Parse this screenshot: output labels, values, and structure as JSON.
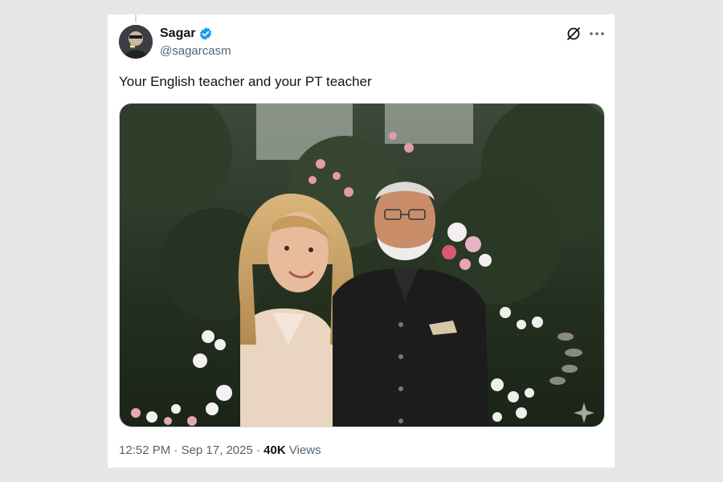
{
  "tweet": {
    "author": {
      "display_name": "Sagar",
      "handle": "@sagarcasm",
      "verified": true,
      "verified_color": "#1d9bf0"
    },
    "text": "Your English teacher and your PT teacher",
    "media": {
      "icon": "sparkle-watermark-icon"
    },
    "meta": {
      "time": "12:52 PM",
      "separator": "·",
      "date": "Sep 17, 2025",
      "views_count": "40K",
      "views_label": "Views"
    },
    "actions": {
      "grok_icon": "grok-icon",
      "more_icon": "more-icon"
    }
  }
}
